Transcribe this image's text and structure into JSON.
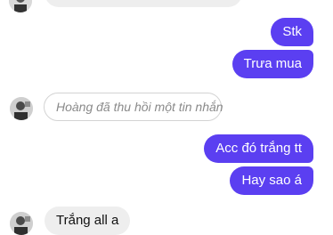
{
  "colors": {
    "outgoing_bubble": "#5b3ff1",
    "incoming_bubble": "#eeeeee",
    "recalled_border": "#d3d3d3",
    "recalled_text": "#8a8a8a",
    "background": "#ffffff"
  },
  "conversation": {
    "messages": [
      {
        "direction": "incoming",
        "text": ""
      },
      {
        "direction": "outgoing",
        "text": "Stk"
      },
      {
        "direction": "outgoing",
        "text": "Trưa mua"
      },
      {
        "direction": "incoming",
        "text": "Hoàng đã thu hồi một tin nhắn",
        "recalled": true
      },
      {
        "direction": "outgoing",
        "text": "Acc đó trắng tt"
      },
      {
        "direction": "outgoing",
        "text": "Hay sao á"
      },
      {
        "direction": "incoming",
        "text": "Trắng all a"
      }
    ]
  }
}
